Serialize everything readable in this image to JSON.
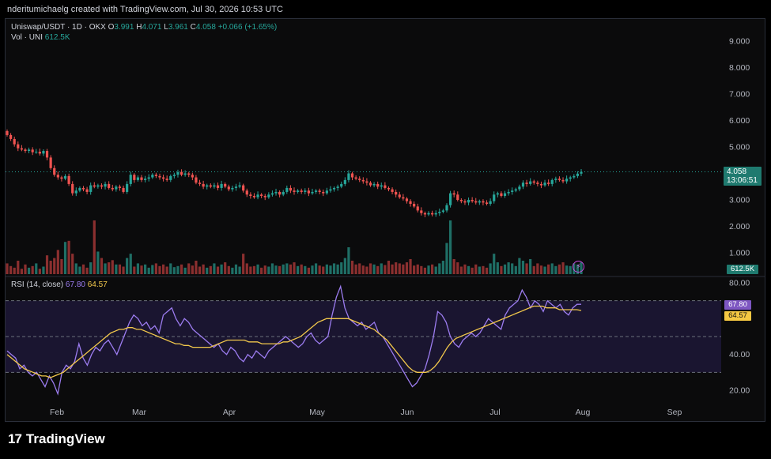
{
  "header": {
    "credit": "nderitumichaelg created with TradingView.com, Jul 30, 2026 10:53 UTC"
  },
  "legend": {
    "symbol": "Uniswap/USDT · 1D · OKX",
    "o_label": "O",
    "o_value": "3.991",
    "h_label": "H",
    "h_value": "4.071",
    "l_label": "L",
    "l_value": "3.961",
    "c_label": "C",
    "c_value": "4.058",
    "change": "+0.066 (+1.65%)",
    "vol_label": "Vol · UNI",
    "vol_value": "612.5K",
    "rsi_label": "RSI (14, close)",
    "rsi_value": "67.80",
    "rsi_ma_value": "64.57"
  },
  "price_tag": {
    "price": "4.058",
    "countdown": "13:06:51"
  },
  "vol_tag": "612.5K",
  "rsi_tags": {
    "rsi": "67.80",
    "ma": "64.57"
  },
  "footer": {
    "brand": "TradingView"
  },
  "colors": {
    "up": "#26a69a",
    "down": "#ef5350",
    "rsi": "#9c7cf0",
    "rsi_ma": "#f2c84b"
  },
  "chart_data": [
    {
      "type": "candlestick",
      "title": "Uniswap/USDT · 1D · OKX",
      "y_ticks": [
        "9.000",
        "8.000",
        "7.000",
        "6.000",
        "5.000",
        "3.000",
        "2.000",
        "1.000"
      ],
      "ylim": [
        0.5,
        9.5
      ],
      "x_ticks": [
        "Feb",
        "Mar",
        "Apr",
        "May",
        "Jun",
        "Jul",
        "Aug",
        "Sep"
      ],
      "last_close": 4.058,
      "closes": [
        5.45,
        5.3,
        5.1,
        4.95,
        4.9,
        4.85,
        4.9,
        4.8,
        4.82,
        4.75,
        4.85,
        4.6,
        4.2,
        3.95,
        3.85,
        3.8,
        3.9,
        3.6,
        3.25,
        3.35,
        3.45,
        3.4,
        3.3,
        3.55,
        3.5,
        3.55,
        3.5,
        3.6,
        3.45,
        3.4,
        3.5,
        3.45,
        3.3,
        3.6,
        3.95,
        3.75,
        3.85,
        3.75,
        3.8,
        3.85,
        3.95,
        3.9,
        3.85,
        3.8,
        3.75,
        3.9,
        3.95,
        4.05,
        3.95,
        4.0,
        3.95,
        3.85,
        3.65,
        3.6,
        3.5,
        3.55,
        3.5,
        3.55,
        3.45,
        3.6,
        3.5,
        3.4,
        3.45,
        3.5,
        3.55,
        3.35,
        3.2,
        3.15,
        3.1,
        3.2,
        3.15,
        3.1,
        3.2,
        3.25,
        3.3,
        3.2,
        3.3,
        3.45,
        3.35,
        3.3,
        3.35,
        3.3,
        3.35,
        3.25,
        3.3,
        3.35,
        3.3,
        3.25,
        3.35,
        3.4,
        3.45,
        3.5,
        3.6,
        3.75,
        4.0,
        3.85,
        3.8,
        3.75,
        3.7,
        3.65,
        3.55,
        3.6,
        3.5,
        3.55,
        3.45,
        3.4,
        3.3,
        3.2,
        3.1,
        3.05,
        2.95,
        2.85,
        2.75,
        2.6,
        2.5,
        2.45,
        2.5,
        2.45,
        2.5,
        2.55,
        2.6,
        2.8,
        3.25,
        3.2,
        3.0,
        2.95,
        2.9,
        3.0,
        2.95,
        2.9,
        2.95,
        2.9,
        2.85,
        2.95,
        3.2,
        3.25,
        3.15,
        3.25,
        3.3,
        3.35,
        3.4,
        3.5,
        3.65,
        3.6,
        3.7,
        3.65,
        3.6,
        3.55,
        3.65,
        3.6,
        3.75,
        3.8,
        3.75,
        3.7,
        3.8,
        3.85,
        3.9,
        3.991,
        4.058
      ]
    },
    {
      "type": "bar",
      "title": "Vol · UNI",
      "last_value": "612.5K",
      "relative_volumes": [
        0.2,
        0.15,
        0.12,
        0.25,
        0.1,
        0.18,
        0.12,
        0.15,
        0.2,
        0.1,
        0.14,
        0.35,
        0.25,
        0.3,
        0.45,
        0.28,
        0.6,
        0.62,
        0.38,
        0.2,
        0.14,
        0.18,
        0.12,
        0.22,
        1.0,
        0.42,
        0.3,
        0.2,
        0.22,
        0.26,
        0.18,
        0.18,
        0.14,
        0.3,
        0.38,
        0.14,
        0.2,
        0.16,
        0.18,
        0.12,
        0.17,
        0.2,
        0.15,
        0.18,
        0.14,
        0.2,
        0.13,
        0.15,
        0.18,
        0.12,
        0.2,
        0.16,
        0.25,
        0.14,
        0.18,
        0.12,
        0.15,
        0.2,
        0.14,
        0.18,
        0.22,
        0.15,
        0.12,
        0.18,
        0.14,
        0.38,
        0.2,
        0.14,
        0.15,
        0.18,
        0.12,
        0.16,
        0.14,
        0.2,
        0.16,
        0.15,
        0.18,
        0.2,
        0.18,
        0.22,
        0.15,
        0.18,
        0.15,
        0.12,
        0.16,
        0.2,
        0.16,
        0.14,
        0.18,
        0.16,
        0.2,
        0.18,
        0.22,
        0.3,
        0.5,
        0.25,
        0.18,
        0.2,
        0.16,
        0.14,
        0.2,
        0.18,
        0.15,
        0.2,
        0.17,
        0.25,
        0.18,
        0.22,
        0.2,
        0.18,
        0.22,
        0.28,
        0.16,
        0.18,
        0.15,
        0.12,
        0.16,
        0.18,
        0.14,
        0.2,
        0.25,
        0.58,
        1.0,
        0.28,
        0.22,
        0.14,
        0.18,
        0.15,
        0.12,
        0.18,
        0.14,
        0.15,
        0.12,
        0.2,
        0.38,
        0.22,
        0.15,
        0.18,
        0.22,
        0.2,
        0.15,
        0.3,
        0.25,
        0.2,
        0.28,
        0.15,
        0.2,
        0.16,
        0.14,
        0.18,
        0.2,
        0.15,
        0.18,
        0.22,
        0.16,
        0.15,
        0.2,
        0.18,
        0.22
      ]
    },
    {
      "type": "line",
      "title": "RSI (14, close)",
      "y_ticks": [
        "80.00",
        "40.00",
        "20.00"
      ],
      "ylim": [
        15,
        85
      ],
      "levels": [
        70,
        50,
        30
      ],
      "series": [
        {
          "name": "RSI",
          "values": [
            42,
            40,
            38,
            32,
            34,
            30,
            28,
            30,
            26,
            22,
            28,
            24,
            18,
            30,
            34,
            32,
            36,
            46,
            38,
            34,
            40,
            44,
            42,
            46,
            48,
            44,
            40,
            46,
            52,
            58,
            62,
            60,
            56,
            58,
            54,
            56,
            52,
            62,
            64,
            66,
            60,
            56,
            60,
            58,
            54,
            52,
            50,
            48,
            46,
            44,
            46,
            42,
            40,
            44,
            42,
            38,
            36,
            40,
            38,
            42,
            40,
            38,
            42,
            44,
            46,
            48,
            50,
            48,
            46,
            44,
            46,
            50,
            52,
            48,
            46,
            48,
            50,
            62,
            72,
            78,
            66,
            60,
            58,
            56,
            58,
            54,
            56,
            58,
            52,
            50,
            46,
            42,
            38,
            34,
            30,
            26,
            22,
            24,
            28,
            32,
            40,
            50,
            64,
            62,
            58,
            50,
            46,
            44,
            48,
            50,
            52,
            50,
            52,
            56,
            60,
            58,
            56,
            54,
            62,
            66,
            68,
            70,
            76,
            72,
            66,
            70,
            68,
            64,
            70,
            68,
            66,
            68,
            64,
            62,
            66,
            68,
            68
          ]
        },
        {
          "name": "RSI-based MA",
          "values": [
            40,
            38,
            36,
            34,
            32,
            31,
            30,
            29,
            28,
            28,
            27,
            28,
            29,
            30,
            32,
            34,
            36,
            38,
            40,
            42,
            44,
            46,
            48,
            50,
            52,
            53,
            54,
            54,
            55,
            55,
            54,
            54,
            53,
            52,
            51,
            50,
            49,
            48,
            47,
            46,
            46,
            45,
            45,
            44,
            44,
            44,
            44,
            44,
            45,
            46,
            47,
            48,
            48,
            48,
            48,
            48,
            47,
            47,
            47,
            46,
            46,
            46,
            46,
            46,
            47,
            47,
            48,
            49,
            50,
            52,
            54,
            56,
            58,
            59,
            60,
            60,
            60,
            60,
            60,
            60,
            59,
            58,
            57,
            56,
            55,
            54,
            52,
            50,
            48,
            45,
            42,
            39,
            36,
            33,
            31,
            30,
            30,
            30,
            31,
            33,
            36,
            40,
            44,
            47,
            49,
            50,
            51,
            52,
            53,
            54,
            55,
            56,
            57,
            58,
            59,
            60,
            61,
            62,
            63,
            64,
            65,
            66,
            67,
            67,
            67,
            66,
            66,
            66,
            65,
            65,
            65,
            65,
            65,
            64.57
          ]
        }
      ]
    }
  ]
}
